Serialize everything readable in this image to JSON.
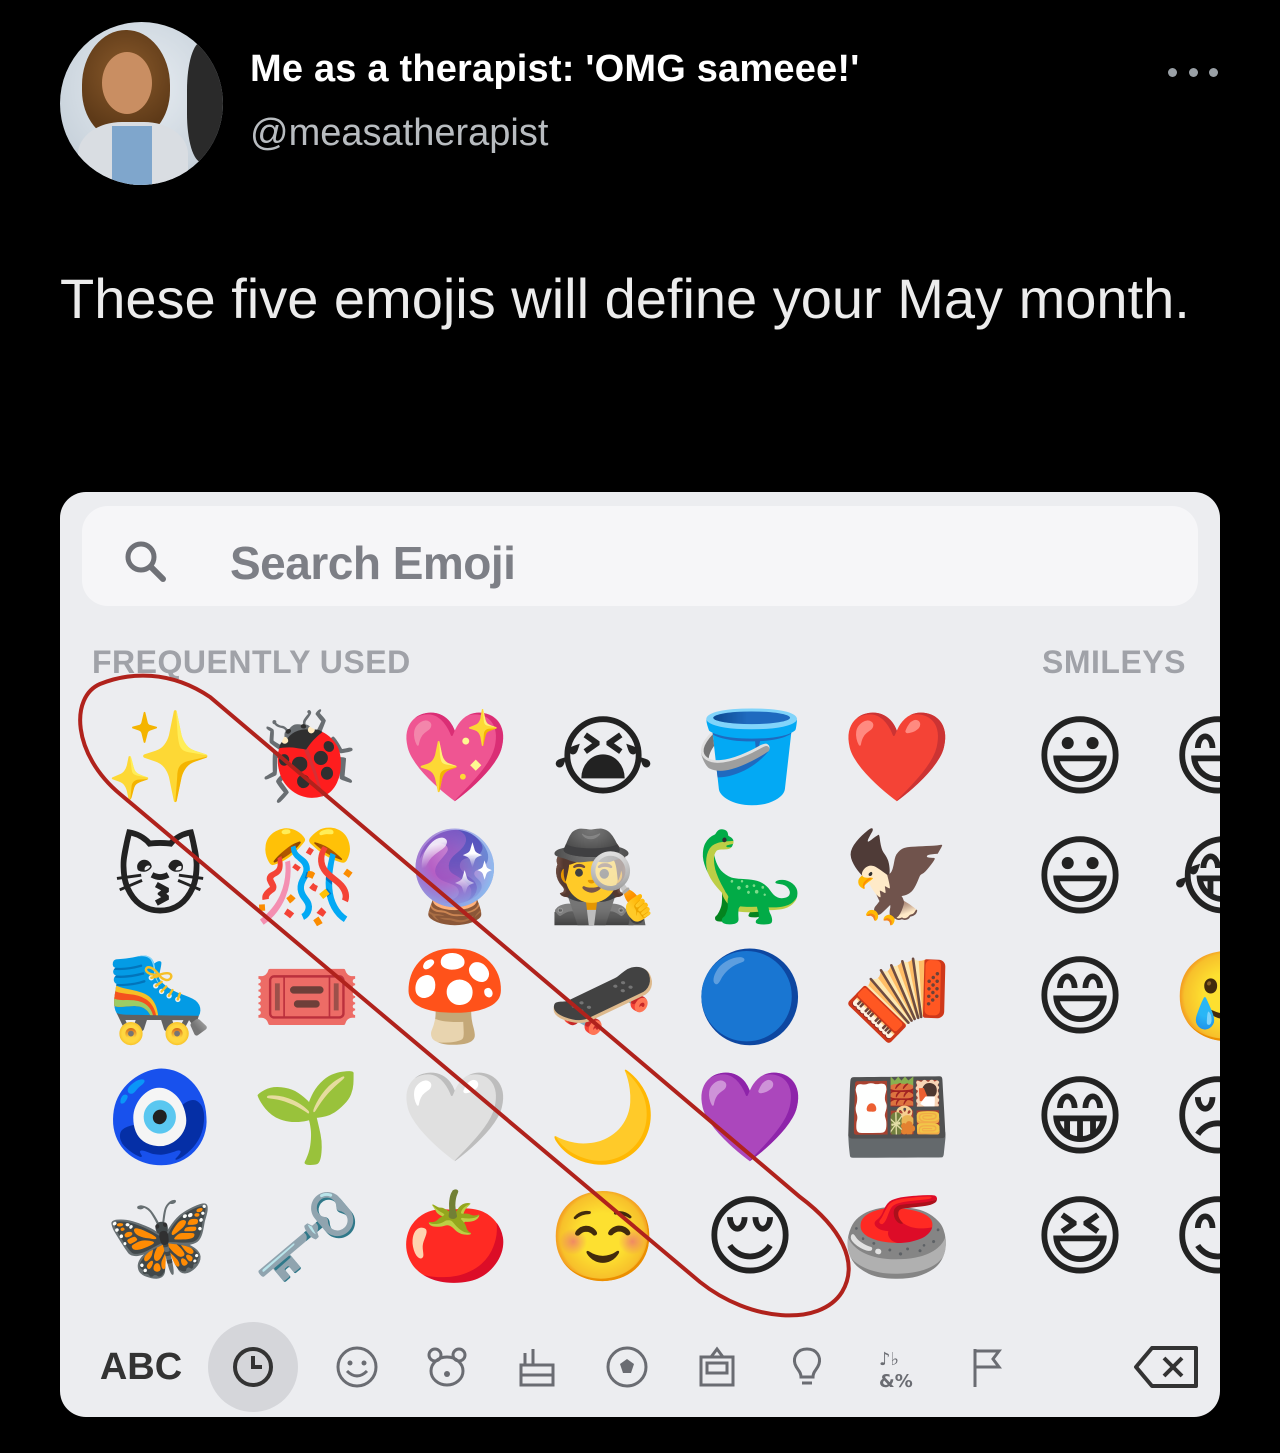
{
  "tweet": {
    "display_name": "Me as a therapist: 'OMG sameee!'",
    "handle": "@measatherapist",
    "more_icon": "more-dots-icon",
    "text": "These five emojis will define your May month."
  },
  "keyboard": {
    "search_placeholder": "Search Emoji",
    "search_icon": "search-icon",
    "section_frequent": "FREQUENTLY USED",
    "section_smileys": "SMILEYS",
    "highlight_color": "#b0221c",
    "grid": [
      [
        "✨",
        "🐞",
        "💖",
        "😭",
        "🪣",
        "❤️",
        "😃"
      ],
      [
        "😽",
        "🎊",
        "🔮",
        "🕵️",
        "🦕",
        "🦅",
        "😃"
      ],
      [
        "🛼",
        "🎟️",
        "🍄",
        "🛹",
        "🔵",
        "🪗",
        "😄"
      ],
      [
        "🧿",
        "🌱",
        "🤍",
        "🌙",
        "💜",
        "🍱",
        "😁"
      ],
      [
        "🦋",
        "🗝️",
        "🍅",
        "☺️",
        "😌",
        "🥌",
        "😆"
      ]
    ],
    "partial_column": [
      "😅",
      "😂",
      "🥲",
      "😢",
      "😊"
    ],
    "tabs": {
      "abc_label": "ABC",
      "icons": [
        "recent-clock-icon",
        "smiley-icon",
        "animal-icon",
        "food-icon",
        "activity-ball-icon",
        "travel-icon",
        "objects-bulb-icon",
        "symbols-icon",
        "flag-icon",
        "delete-backspace-icon"
      ]
    }
  }
}
